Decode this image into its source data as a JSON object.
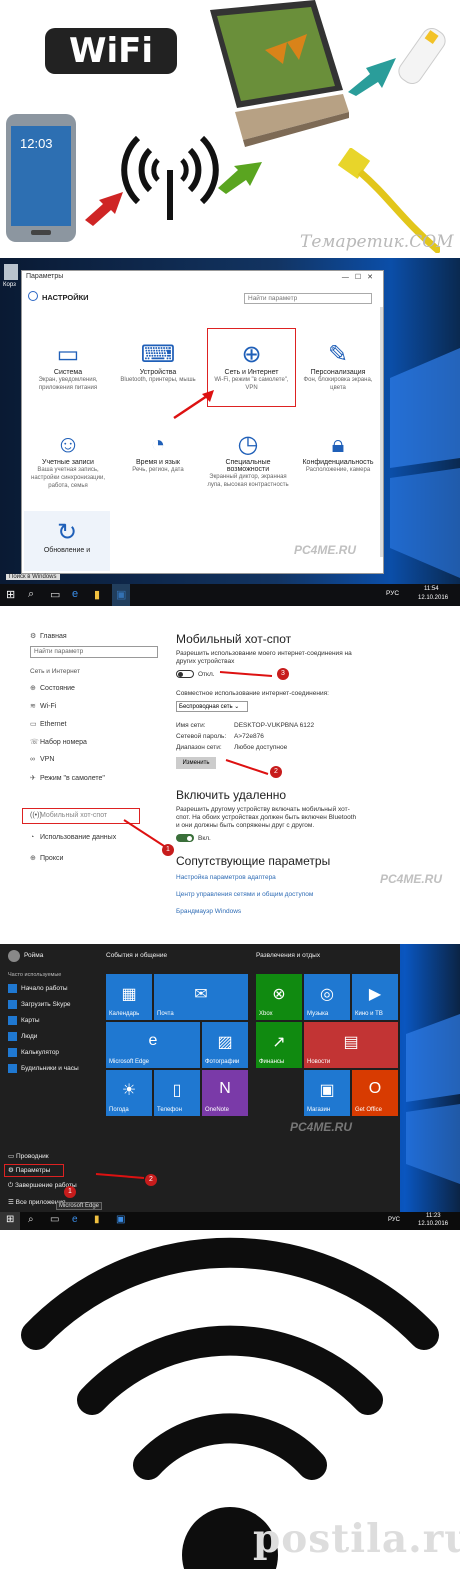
{
  "panel1": {
    "wifi_logo": "WiFi",
    "watermark": "Темаретик.СОМ",
    "phone_time": "12:03"
  },
  "panel2": {
    "window_title": "Параметры",
    "header": "НАСТРОЙКИ",
    "search_placeholder": "Найти параметр",
    "tiles": [
      {
        "title": "Система",
        "sub": "Экран, уведомления, приложения питания",
        "icon": "laptop-icon"
      },
      {
        "title": "Устройства",
        "sub": "Bluetooth, принтеры, мышь",
        "icon": "keyboard-icon"
      },
      {
        "title": "Сеть и Интернет",
        "sub": "Wi-Fi, режим \"в самолете\", VPN",
        "icon": "globe-icon"
      },
      {
        "title": "Персонализация",
        "sub": "Фон, блокировка экрана, цвета",
        "icon": "paint-icon"
      },
      {
        "title": "Учетные записи",
        "sub": "Ваша учетная запись, настройки синхронизации, работа, семья",
        "icon": "person-icon"
      },
      {
        "title": "Время и язык",
        "sub": "Речь, регион, дата",
        "icon": "time-lang-icon"
      },
      {
        "title": "Специальные возможности",
        "sub": "Экранный диктор, экранная лупа, высокая контрастность",
        "icon": "ease-icon"
      },
      {
        "title": "Конфиденциальность",
        "sub": "Расположение, камера",
        "icon": "lock-icon"
      },
      {
        "title": "Обновление и",
        "sub": "",
        "icon": "update-icon"
      }
    ],
    "watermark": "PC4ME.RU",
    "search_windows": "Поиск в Windows",
    "tray_lang": "РУС",
    "tray_time": "11:54",
    "tray_date": "12.10.2016",
    "desktop_label": "Корз"
  },
  "panel3": {
    "nav": [
      {
        "label": "Главная",
        "icon": "gear-icon"
      },
      {
        "label": "Состояние",
        "icon": "globe-icon"
      },
      {
        "label": "Wi-Fi",
        "icon": "wifi-icon"
      },
      {
        "label": "Ethernet",
        "icon": "ethernet-icon"
      },
      {
        "label": "Набор номера",
        "icon": "dialup-icon"
      },
      {
        "label": "VPN",
        "icon": "vpn-icon"
      },
      {
        "label": "Режим \"в самолете\"",
        "icon": "airplane-icon"
      },
      {
        "label": "Мобильный хот-спот",
        "icon": "hotspot-icon"
      },
      {
        "label": "Использование данных",
        "icon": "data-usage-icon"
      },
      {
        "label": "Прокси",
        "icon": "proxy-icon"
      }
    ],
    "search_placeholder": "Найти параметр",
    "section_label": "Сеть и Интернет",
    "title": "Мобильный хот-спот",
    "share_desc": "Разрешить использование моего интернет-соединения на других устройствах",
    "toggle1_state": "Откл.",
    "share_from_label": "Совместное использование интернет-соединения:",
    "share_from_value": "Беспроводная сеть",
    "net_name_label": "Имя сети:",
    "net_name_value": "DESKTOP-VUKPBNA 6122",
    "net_pass_label": "Сетевой пароль:",
    "net_pass_value": "A>72e876",
    "net_range_label": "Диапазон сети:",
    "net_range_value": "Любое доступное",
    "edit_button": "Изменить",
    "remote_title": "Включить удаленно",
    "remote_desc": "Разрешить другому устройству включать мобильный хот-спот. На обоих устройствах должен быть включен Bluetooth и они должны быть сопряжены друг с другом.",
    "toggle2_state": "Вкл.",
    "related_title": "Сопутствующие параметры",
    "related_links": [
      "Настройка параметров адаптера",
      "Центр управления сетями и общим доступом",
      "Брандмауэр Windows"
    ],
    "watermark": "PC4ME.RU",
    "badges": [
      "1",
      "2",
      "3"
    ]
  },
  "panel4": {
    "user": "Ройма",
    "frequent_label": "Часто используемые",
    "apps": [
      "Начало работы",
      "Загрузить Skype",
      "Карты",
      "Люди",
      "Калькулятор",
      "Будильники и часы"
    ],
    "bottom": [
      "Проводник",
      "Параметры",
      "Завершение работы",
      "Все приложения"
    ],
    "group1_title": "События и общение",
    "group2_title": "Развлечения и отдых",
    "tiles": [
      {
        "label": "Календарь",
        "icon": "calendar-icon",
        "color": "#1f78d1"
      },
      {
        "label": "Почта",
        "icon": "mail-icon",
        "color": "#1f78d1"
      },
      {
        "label": "Microsoft Edge",
        "icon": "edge-icon",
        "color": "#1f78d1"
      },
      {
        "label": "Фотографии",
        "icon": "photos-icon",
        "color": "#1f78d1"
      },
      {
        "label": "Погода",
        "icon": "weather-icon",
        "color": "#1f78d1"
      },
      {
        "label": "Телефон",
        "icon": "phone-icon",
        "color": "#1f78d1"
      },
      {
        "label": "OneNote",
        "icon": "onenote-icon",
        "color": "#7a3aa8"
      },
      {
        "label": "Xbox",
        "icon": "xbox-icon",
        "color": "#108a10"
      },
      {
        "label": "Музыка",
        "icon": "music-icon",
        "color": "#1f78d1"
      },
      {
        "label": "Кино и ТВ",
        "icon": "film-icon",
        "color": "#1f78d1"
      },
      {
        "label": "Финансы",
        "icon": "finance-icon",
        "color": "#108a10"
      },
      {
        "label": "Новости",
        "icon": "news-icon",
        "color": "#c23434"
      },
      {
        "label": "Магазин",
        "icon": "store-icon",
        "color": "#1f78d1"
      },
      {
        "label": "Get Office",
        "icon": "office-icon",
        "color": "#d83b01"
      }
    ],
    "tooltip": "Microsoft Edge",
    "tray_lang": "РУС",
    "tray_time": "11:23",
    "tray_date": "12.10.2016",
    "watermark": "PC4ME.RU",
    "badges": [
      "1",
      "2"
    ]
  },
  "panel5": {
    "watermark": "postila.ru"
  }
}
